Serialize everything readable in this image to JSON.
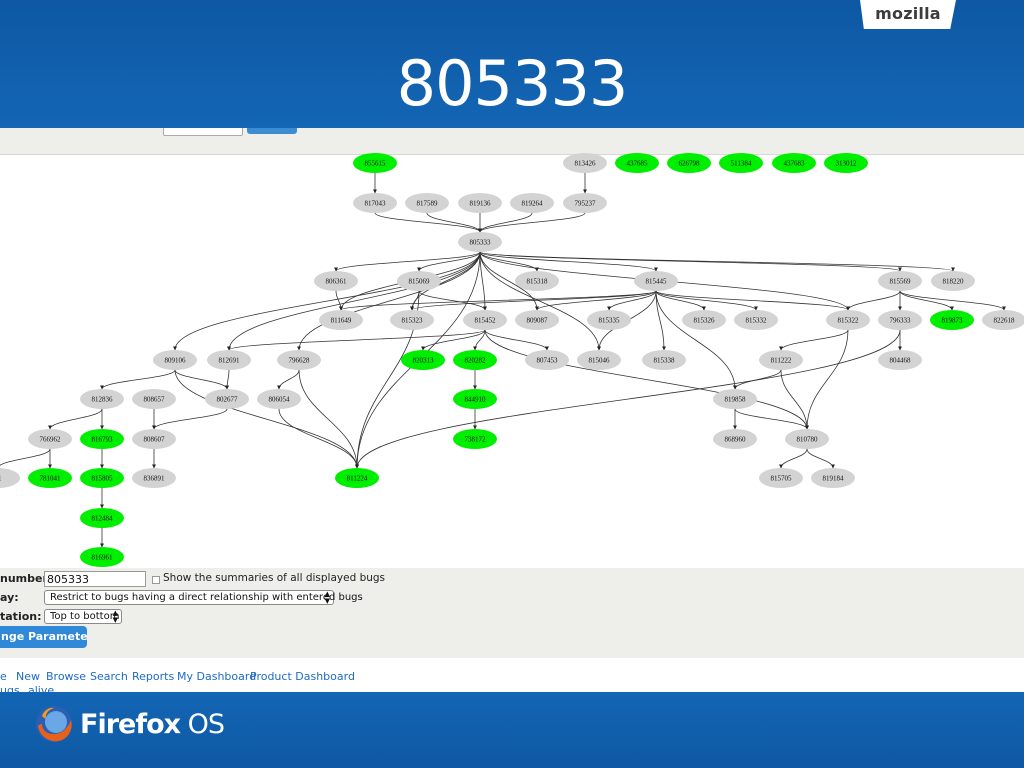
{
  "slide": {
    "title": "805333",
    "brand": "mozilla",
    "footer_brand_main": "Firefox",
    "footer_brand_os": " OS"
  },
  "colors": {
    "band": "#0f5ba8",
    "node_default": "#d3d3d3",
    "node_highlight": "#00ee00"
  },
  "graph": {
    "nodes": [
      {
        "id": "855615",
        "hl": true
      },
      {
        "id": "817043",
        "hl": false
      },
      {
        "id": "817589",
        "hl": false
      },
      {
        "id": "819136",
        "hl": false
      },
      {
        "id": "819264",
        "hl": false
      },
      {
        "id": "813426",
        "hl": false
      },
      {
        "id": "795237",
        "hl": false
      },
      {
        "id": "437685",
        "hl": true
      },
      {
        "id": "626798",
        "hl": true
      },
      {
        "id": "511384",
        "hl": true
      },
      {
        "id": "437683",
        "hl": true
      },
      {
        "id": "313012",
        "hl": true
      },
      {
        "id": "805333",
        "hl": false
      },
      {
        "id": "806361",
        "hl": false
      },
      {
        "id": "815069",
        "hl": false
      },
      {
        "id": "815318",
        "hl": false
      },
      {
        "id": "815445",
        "hl": false
      },
      {
        "id": "815569",
        "hl": false
      },
      {
        "id": "818220",
        "hl": false
      },
      {
        "id": "811649",
        "hl": false
      },
      {
        "id": "815323",
        "hl": false
      },
      {
        "id": "815452",
        "hl": false
      },
      {
        "id": "809087",
        "hl": false
      },
      {
        "id": "815335",
        "hl": false
      },
      {
        "id": "815326",
        "hl": false
      },
      {
        "id": "815332",
        "hl": false
      },
      {
        "id": "815322",
        "hl": false
      },
      {
        "id": "796333",
        "hl": false
      },
      {
        "id": "819873",
        "hl": true
      },
      {
        "id": "822618",
        "hl": false
      },
      {
        "id": "809106",
        "hl": false
      },
      {
        "id": "812691",
        "hl": false
      },
      {
        "id": "796628",
        "hl": false
      },
      {
        "id": "820313",
        "hl": true
      },
      {
        "id": "820282",
        "hl": true
      },
      {
        "id": "807453",
        "hl": false
      },
      {
        "id": "815046",
        "hl": false
      },
      {
        "id": "815338",
        "hl": false
      },
      {
        "id": "811222",
        "hl": false
      },
      {
        "id": "804468",
        "hl": false
      },
      {
        "id": "812836",
        "hl": false
      },
      {
        "id": "808657",
        "hl": false
      },
      {
        "id": "802677",
        "hl": false
      },
      {
        "id": "806054",
        "hl": false
      },
      {
        "id": "844910",
        "hl": true
      },
      {
        "id": "819858",
        "hl": false
      },
      {
        "id": "766962",
        "hl": false
      },
      {
        "id": "816793",
        "hl": true
      },
      {
        "id": "808607",
        "hl": false
      },
      {
        "id": "738172",
        "hl": true
      },
      {
        "id": "868960",
        "hl": false
      },
      {
        "id": "810780",
        "hl": false
      },
      {
        "id": "71",
        "hl": false
      },
      {
        "id": "781041",
        "hl": true
      },
      {
        "id": "815805",
        "hl": true
      },
      {
        "id": "836891",
        "hl": false
      },
      {
        "id": "811224",
        "hl": true
      },
      {
        "id": "815705",
        "hl": false
      },
      {
        "id": "819184",
        "hl": false
      },
      {
        "id": "812484",
        "hl": true
      },
      {
        "id": "816961",
        "hl": true
      }
    ],
    "edges": [
      [
        "855615",
        "817043"
      ],
      [
        "813426",
        "795237"
      ],
      [
        "817043",
        "805333"
      ],
      [
        "817589",
        "805333"
      ],
      [
        "819136",
        "805333"
      ],
      [
        "819264",
        "805333"
      ],
      [
        "795237",
        "805333"
      ],
      [
        "805333",
        "806361"
      ],
      [
        "805333",
        "815069"
      ],
      [
        "805333",
        "815318"
      ],
      [
        "805333",
        "815445"
      ],
      [
        "805333",
        "815569"
      ],
      [
        "805333",
        "818220"
      ],
      [
        "805333",
        "811649"
      ],
      [
        "805333",
        "815323"
      ],
      [
        "805333",
        "815452"
      ],
      [
        "805333",
        "809087"
      ],
      [
        "805333",
        "809106"
      ],
      [
        "805333",
        "812691"
      ],
      [
        "805333",
        "796628"
      ],
      [
        "805333",
        "815046"
      ],
      [
        "805333",
        "815322"
      ],
      [
        "805333",
        "811224"
      ],
      [
        "806361",
        "811649"
      ],
      [
        "815069",
        "815323"
      ],
      [
        "815069",
        "815452"
      ],
      [
        "815069",
        "811224"
      ],
      [
        "815445",
        "815335"
      ],
      [
        "815445",
        "815326"
      ],
      [
        "815445",
        "815332"
      ],
      [
        "815445",
        "815338"
      ],
      [
        "815445",
        "809087"
      ],
      [
        "815445",
        "815046"
      ],
      [
        "815445",
        "815323"
      ],
      [
        "815445",
        "815322"
      ],
      [
        "815445",
        "811649"
      ],
      [
        "815445",
        "819858"
      ],
      [
        "815569",
        "796333"
      ],
      [
        "815569",
        "819873"
      ],
      [
        "815569",
        "822618"
      ],
      [
        "815569",
        "815322"
      ],
      [
        "815452",
        "820313"
      ],
      [
        "815452",
        "820282"
      ],
      [
        "815452",
        "807453"
      ],
      [
        "815452",
        "812691"
      ],
      [
        "815452",
        "810780"
      ],
      [
        "815322",
        "811222"
      ],
      [
        "815322",
        "810780"
      ],
      [
        "796333",
        "804468"
      ],
      [
        "796333",
        "811224"
      ],
      [
        "809106",
        "812836"
      ],
      [
        "809106",
        "802677"
      ],
      [
        "809106",
        "811224"
      ],
      [
        "812691",
        "802677"
      ],
      [
        "796628",
        "806054"
      ],
      [
        "796628",
        "811224"
      ],
      [
        "820282",
        "844910"
      ],
      [
        "844910",
        "738172"
      ],
      [
        "811222",
        "819858"
      ],
      [
        "811222",
        "810780"
      ],
      [
        "819858",
        "868960"
      ],
      [
        "819858",
        "810780"
      ],
      [
        "812836",
        "766962"
      ],
      [
        "812836",
        "816793"
      ],
      [
        "808657",
        "808607"
      ],
      [
        "802677",
        "808607"
      ],
      [
        "806054",
        "811224"
      ],
      [
        "766962",
        "71"
      ],
      [
        "766962",
        "781041"
      ],
      [
        "816793",
        "815805"
      ],
      [
        "808607",
        "836891"
      ],
      [
        "810780",
        "815705"
      ],
      [
        "810780",
        "819184"
      ],
      [
        "815805",
        "812484"
      ],
      [
        "812484",
        "816961"
      ]
    ]
  },
  "form": {
    "bug_numbers_label": "numbers:",
    "bug_numbers_value": "805333",
    "summaries_label": "Show the summaries of all displayed bugs",
    "display_label": "ay:",
    "display_value": "Restrict to bugs having a direct relationship with entered bugs",
    "orientation_label": "tation:",
    "orientation_value": "Top to bottom",
    "change_button": "nge Parameters"
  },
  "nav": {
    "items": [
      "e",
      "New",
      "Browse",
      "Search",
      "Reports",
      "My Dashboard",
      "Product Dashboard"
    ],
    "row2": [
      "ugs",
      "alive"
    ]
  }
}
